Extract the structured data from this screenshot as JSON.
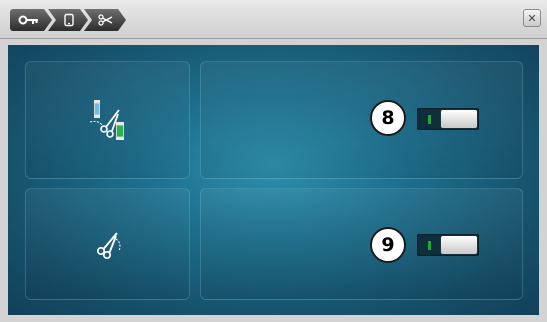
{
  "breadcrumb": {
    "items": [
      {
        "icon": "key-icon"
      },
      {
        "icon": "display-icon"
      },
      {
        "icon": "scissors-icon"
      }
    ]
  },
  "close_icon": "close-icon",
  "settings": [
    {
      "function_icon": "thread-cutter-icon",
      "badge": "8",
      "toggle_on": true
    },
    {
      "function_icon": "scissors-icon",
      "badge": "9",
      "toggle_on": true
    }
  ],
  "colors": {
    "background_center": "#2d90ad",
    "background_edge": "#12405a",
    "toggle_led": "#1fa83a",
    "breadcrumb_fill": "#3a3a3a"
  }
}
